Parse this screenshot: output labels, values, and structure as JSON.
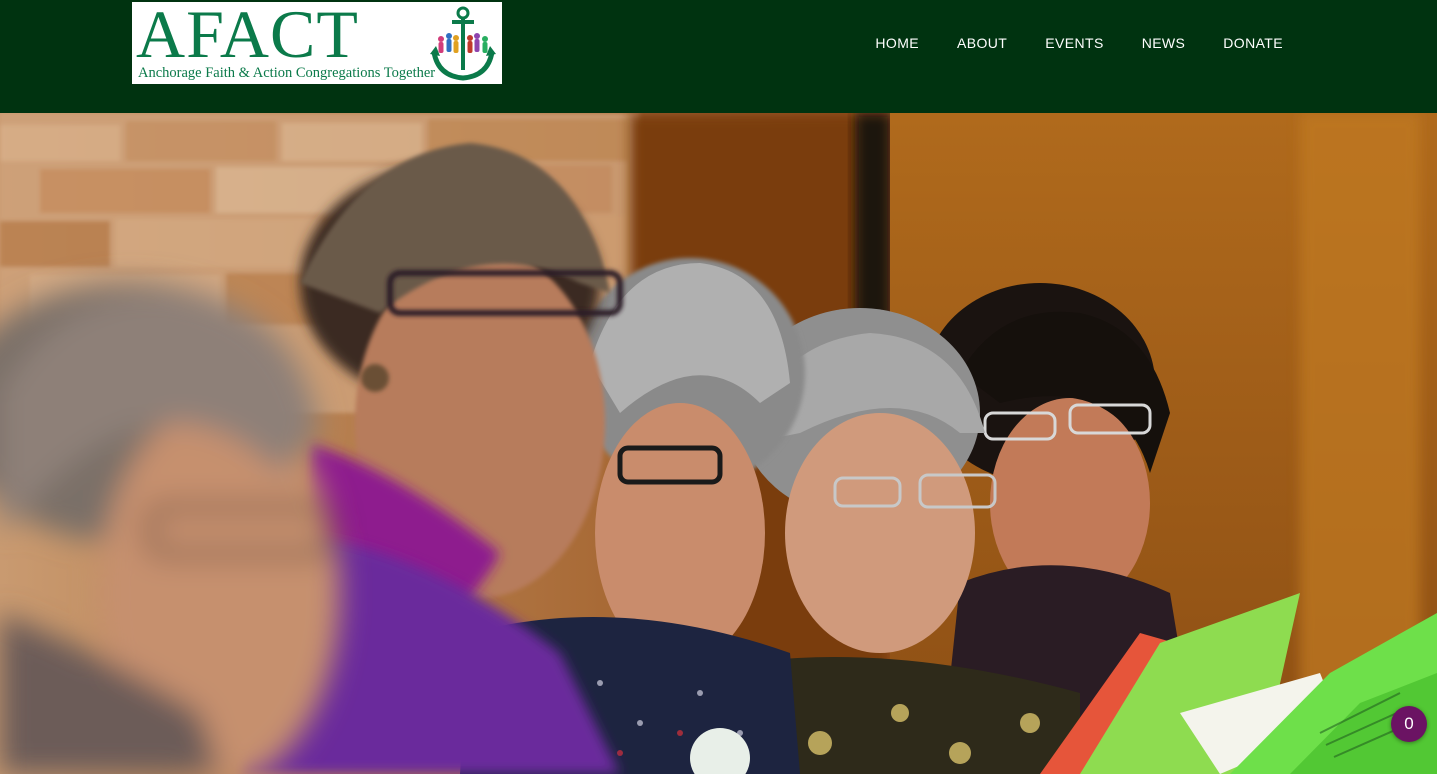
{
  "header": {
    "logo": {
      "wordmark": "AFACT",
      "tagline": "Anchorage Faith & Action Congregations Together",
      "icon": "anchor-with-people-icon",
      "brand_color": "#0b7a4a"
    },
    "background_color": "#003310",
    "nav": [
      {
        "label": "HOME"
      },
      {
        "label": "ABOUT"
      },
      {
        "label": "EVENTS"
      },
      {
        "label": "NEWS"
      },
      {
        "label": "DONATE"
      }
    ]
  },
  "hero": {
    "image": "photo-women-singing-from-hymnals"
  },
  "badge": {
    "count": "0",
    "color": "#6b1363"
  }
}
